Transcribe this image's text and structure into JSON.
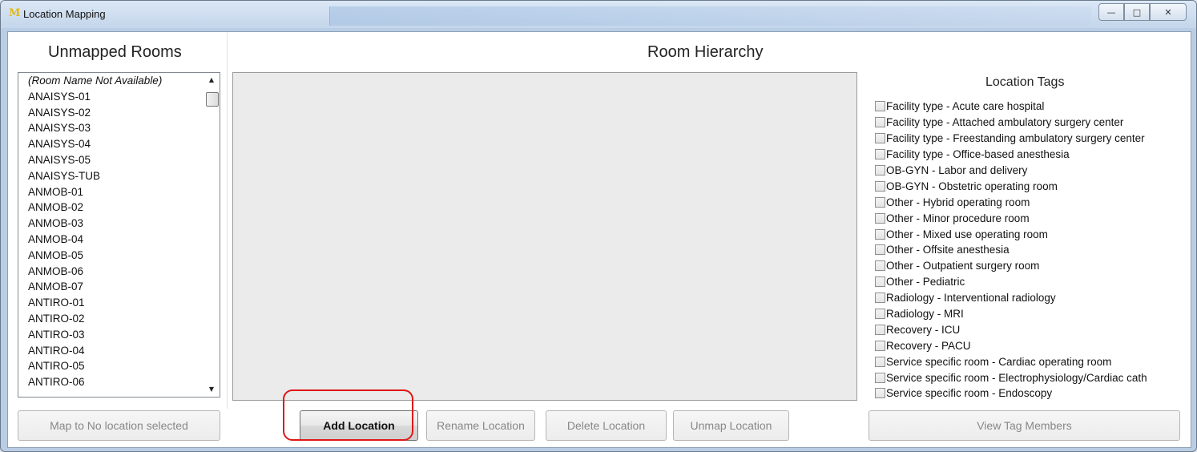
{
  "window": {
    "title": "Location Mapping",
    "app_icon_letter": "M",
    "controls": {
      "minimize": "—",
      "maximize": "□",
      "close": "✕"
    }
  },
  "unmapped_rooms": {
    "heading": "Unmapped Rooms",
    "items": [
      "(Room Name Not Available)",
      "ANAISYS-01",
      "ANAISYS-02",
      "ANAISYS-03",
      "ANAISYS-04",
      "ANAISYS-05",
      "ANAISYS-TUB",
      "ANMOB-01",
      "ANMOB-02",
      "ANMOB-03",
      "ANMOB-04",
      "ANMOB-05",
      "ANMOB-06",
      "ANMOB-07",
      "ANTIRO-01",
      "ANTIRO-02",
      "ANTIRO-03",
      "ANTIRO-04",
      "ANTIRO-05",
      "ANTIRO-06"
    ],
    "scroll_up": "▲",
    "scroll_down": "▼",
    "map_button": "Map to No location selected"
  },
  "room_hierarchy": {
    "heading": "Room Hierarchy",
    "buttons": {
      "add": "Add Location",
      "rename": "Rename Location",
      "delete": "Delete Location",
      "unmap": "Unmap Location"
    }
  },
  "location_tags": {
    "heading": "Location Tags",
    "items": [
      "Facility type - Acute care hospital",
      "Facility type - Attached ambulatory surgery center",
      "Facility type - Freestanding ambulatory surgery center",
      "Facility type - Office-based anesthesia",
      "OB-GYN - Labor and delivery",
      "OB-GYN - Obstetric operating room",
      "Other - Hybrid operating room",
      "Other - Minor procedure room",
      "Other - Mixed use operating room",
      "Other - Offsite anesthesia",
      "Other - Outpatient surgery room",
      "Other - Pediatric",
      "Radiology - Interventional radiology",
      "Radiology - MRI",
      "Recovery - ICU",
      "Recovery - PACU",
      "Service specific room - Cardiac operating room",
      "Service specific room - Electrophysiology/Cardiac cath",
      "Service specific room - Endoscopy"
    ],
    "view_button": "View Tag Members"
  },
  "colors": {
    "highlight": "#e01616",
    "tree_bg": "#ebebeb"
  }
}
